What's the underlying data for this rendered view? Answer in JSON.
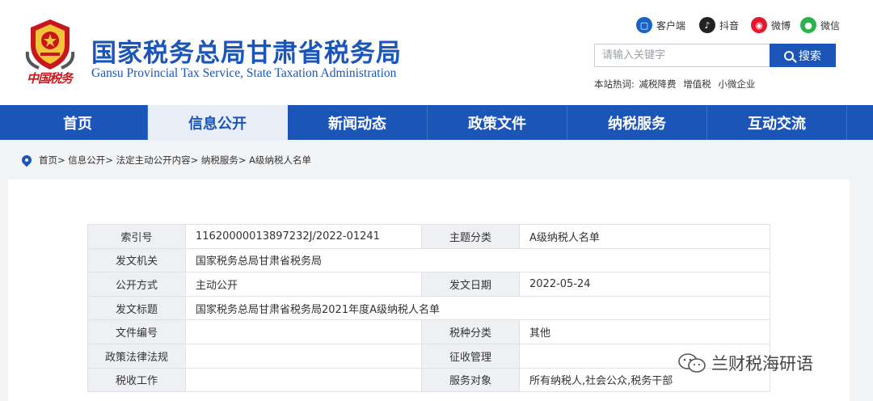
{
  "header": {
    "seal_text": "中国税务",
    "title_cn": "国家税务总局甘肃省税务局",
    "title_en": "Gansu Provincial Tax Service, State Taxation Administration",
    "social": [
      {
        "label": "客户端",
        "icon": "client-icon"
      },
      {
        "label": "抖音",
        "icon": "douyin-icon"
      },
      {
        "label": "微博",
        "icon": "weibo-icon"
      },
      {
        "label": "微信",
        "icon": "wechat-icon"
      }
    ],
    "search": {
      "placeholder": "请输入关键字",
      "button": "搜索"
    },
    "hot": {
      "label": "本站热词:",
      "terms": [
        "减税降费",
        "增值税",
        "小微企业"
      ]
    }
  },
  "nav": [
    "首页",
    "信息公开",
    "新闻动态",
    "政策文件",
    "纳税服务",
    "互动交流"
  ],
  "nav_active": "信息公开",
  "breadcrumb": "首页> 信息公开> 法定主动公开内容> 纳税服务> A级纳税人名单",
  "meta": {
    "index_no": {
      "label": "索引号",
      "value": "11620000013897232J/2022-01241"
    },
    "subject": {
      "label": "主题分类",
      "value": "A级纳税人名单"
    },
    "issuer": {
      "label": "发文机关",
      "value": "国家税务总局甘肃省税务局"
    },
    "disclosure": {
      "label": "公开方式",
      "value": "主动公开"
    },
    "issue_date": {
      "label": "发文日期",
      "value": "2022-05-24"
    },
    "doc_title": {
      "label": "发文标题",
      "value": "国家税务总局甘肃省税务局2021年度A级纳税人名单"
    },
    "doc_no": {
      "label": "文件编号",
      "value": ""
    },
    "tax_type": {
      "label": "税种分类",
      "value": "其他"
    },
    "policy": {
      "label": "政策法律法规",
      "value": ""
    },
    "collection": {
      "label": "征收管理",
      "value": ""
    },
    "tax_work": {
      "label": "税收工作",
      "value": ""
    },
    "audience": {
      "label": "服务对象",
      "value": "所有纳税人,社会公众,税务干部"
    }
  },
  "watermark": {
    "text": "兰财税海研语",
    "icon": "wechat-watermark-icon"
  },
  "colors": {
    "brand": "#1b55b8",
    "seal": "#c8161d"
  }
}
